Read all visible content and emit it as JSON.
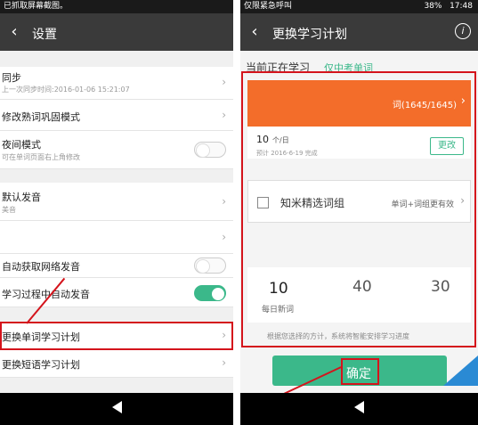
{
  "left": {
    "statusbar": {
      "text": "已抓取屏幕截图。"
    },
    "titlebar": {
      "back_icon": "chevron-left-icon",
      "title": "设置"
    },
    "items": [
      {
        "label": "同步",
        "sub": "上一次同步时间:2016-01-06 15:21:07"
      },
      {
        "label": "修改熟词巩固模式"
      },
      {
        "label": "夜间模式",
        "sub": "可在单词页面右上角修改"
      },
      {
        "label": "默认发音",
        "sub": "美音"
      },
      {
        "label": ""
      },
      {
        "label": "自动获取网络发音"
      },
      {
        "label": "学习过程中自动发音"
      },
      {
        "label": "更换单词学习计划"
      },
      {
        "label": "更换短语学习计划"
      }
    ],
    "accent_color": "#3bb88a",
    "highlight_color": "#d4141c"
  },
  "right": {
    "statusbar": {
      "left_text": "仅限紧急呼叫",
      "battery": "38%",
      "time": "17:48"
    },
    "titlebar": {
      "back_icon": "chevron-left-icon",
      "title": "更换学习计划",
      "info_icon": "info-icon"
    },
    "current_label": "当前正在学习",
    "current_book": "仅中考单词",
    "book_card": {
      "progress": "词(1645/1645)",
      "daily": "10",
      "daily_unit": "个/日",
      "forecast": "预计 2016-6-19 完成",
      "change_button": "更改"
    },
    "group_option": {
      "label": "知米精选词组",
      "desc": "单词+词组更有效"
    },
    "picker": {
      "values": [
        "10",
        "40",
        "30"
      ],
      "caption": "每日新词"
    },
    "hint": "根据您选择的方计，系统将智能安排学习进度",
    "confirm_button": "确定",
    "accent_color": "#3bb88a",
    "banner_color": "#f36d2a"
  }
}
